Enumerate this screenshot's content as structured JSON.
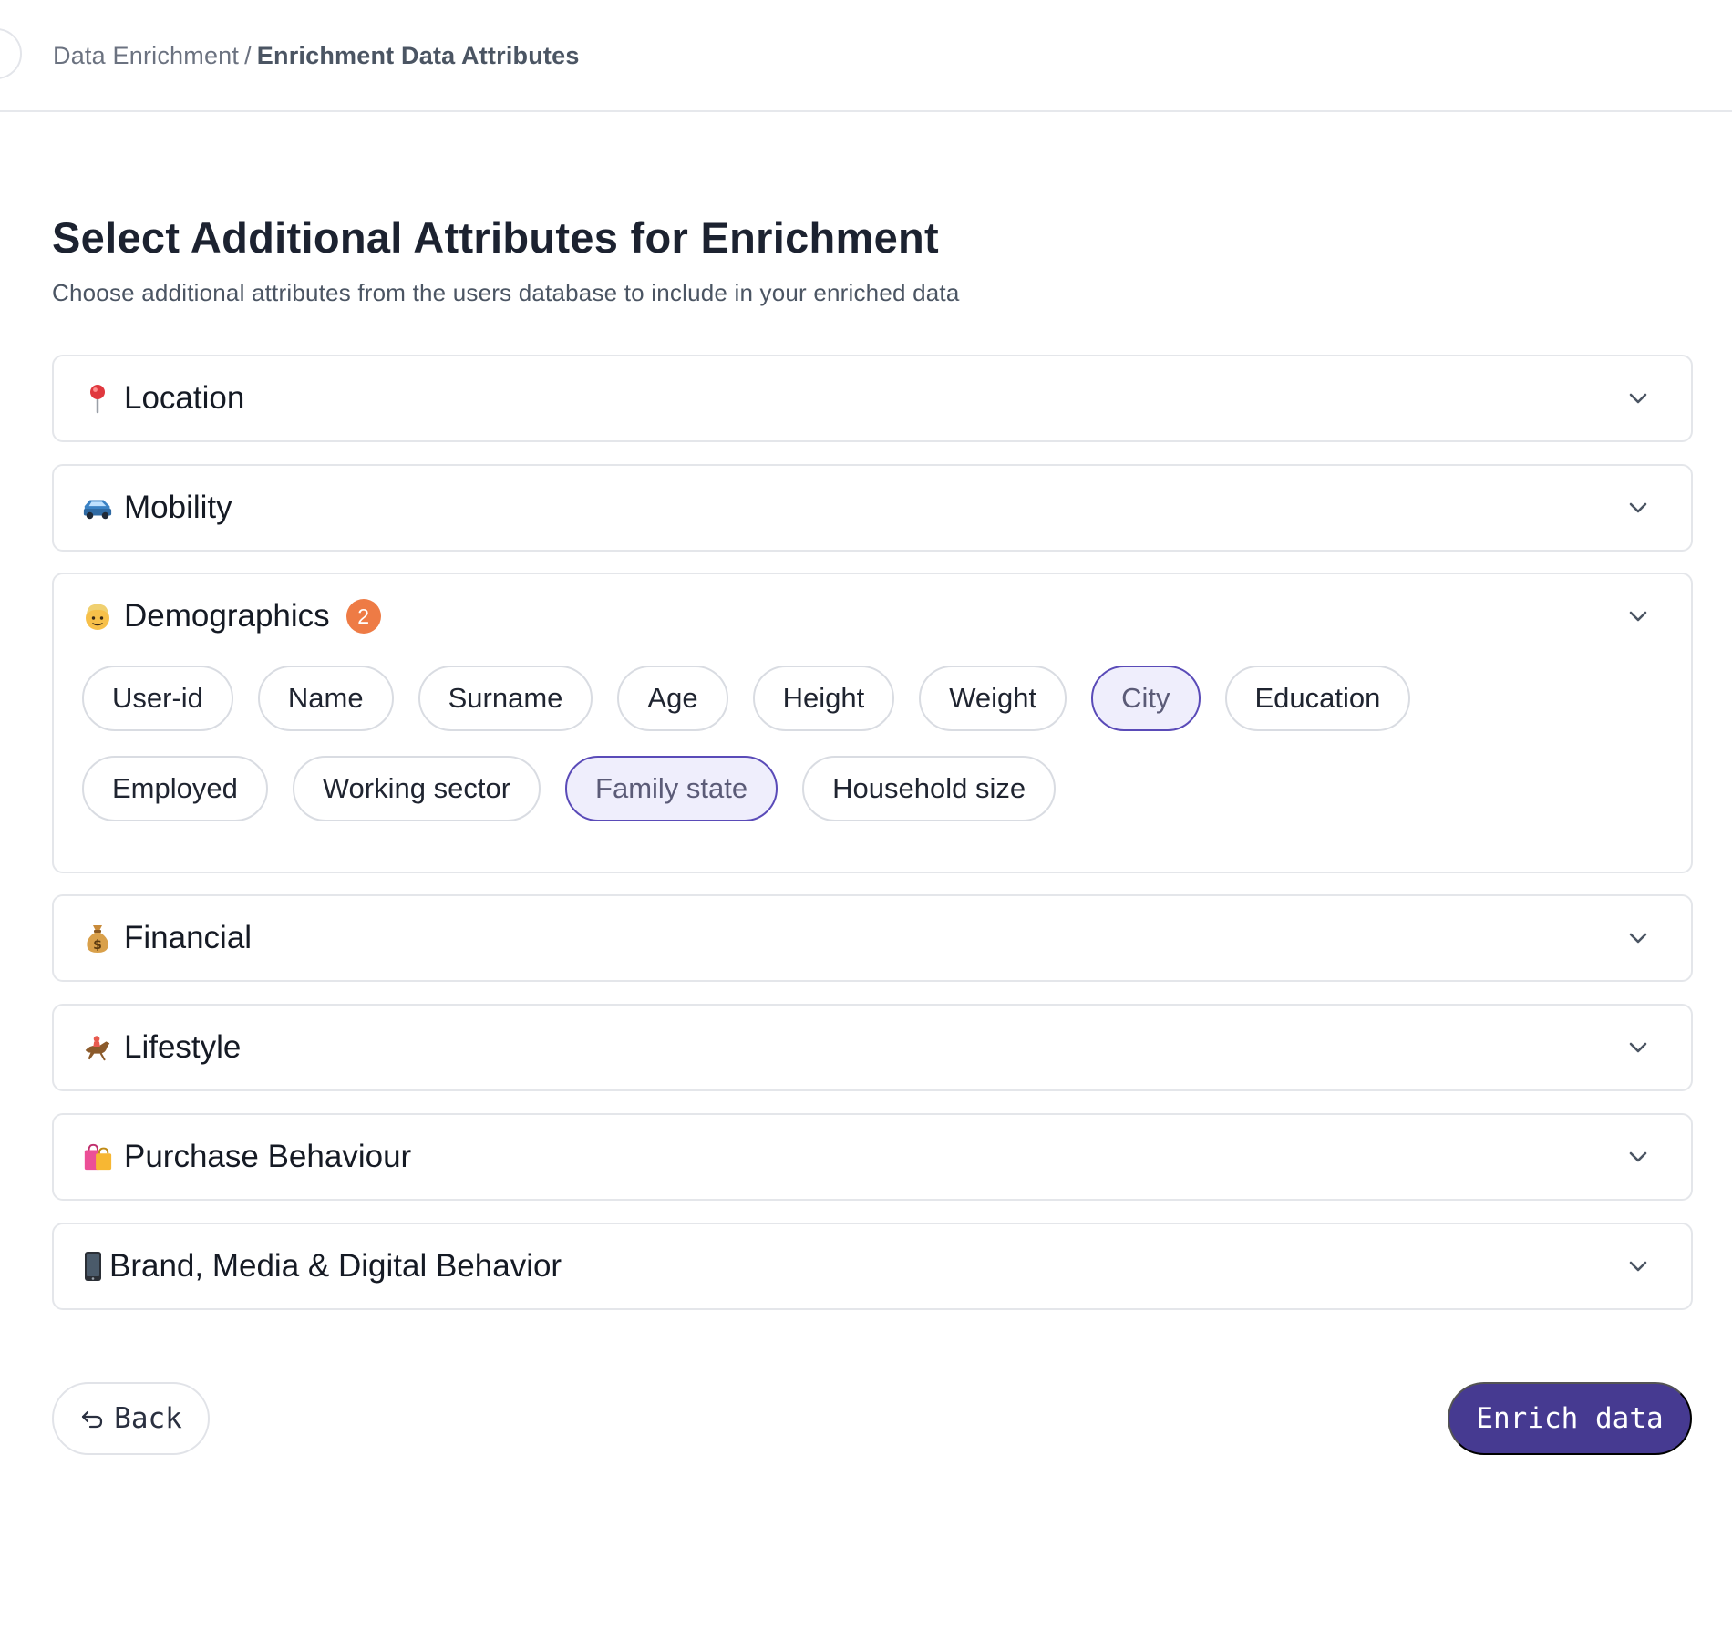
{
  "breadcrumb": {
    "parent": "Data Enrichment",
    "separator": "/",
    "current": "Enrichment Data Attributes"
  },
  "page": {
    "title": "Select Additional Attributes for Enrichment",
    "subtitle": "Choose additional attributes from the users database to include in your enriched data"
  },
  "sections": [
    {
      "label": "Location",
      "icon": "pin-icon",
      "expanded": false
    },
    {
      "label": "Mobility",
      "icon": "car-icon",
      "expanded": false
    },
    {
      "label": "Demographics",
      "icon": "person-icon",
      "expanded": true,
      "badge": "2",
      "chips_row1": [
        {
          "label": "User-id",
          "selected": false
        },
        {
          "label": "Name",
          "selected": false
        },
        {
          "label": "Surname",
          "selected": false
        },
        {
          "label": "Age",
          "selected": false
        },
        {
          "label": "Height",
          "selected": false
        },
        {
          "label": "Weight",
          "selected": false
        },
        {
          "label": "City",
          "selected": true
        },
        {
          "label": "Education",
          "selected": false
        }
      ],
      "chips_row2": [
        {
          "label": "Employed",
          "selected": false
        },
        {
          "label": "Working sector",
          "selected": false
        },
        {
          "label": "Family state",
          "selected": true
        },
        {
          "label": "Household size",
          "selected": false
        }
      ]
    },
    {
      "label": "Financial",
      "icon": "money-bag-icon",
      "expanded": false
    },
    {
      "label": "Lifestyle",
      "icon": "horse-racing-icon",
      "expanded": false
    },
    {
      "label": "Purchase Behaviour",
      "icon": "shopping-bags-icon",
      "expanded": false
    },
    {
      "label": "Brand, Media & Digital Behavior",
      "icon": "mobile-phone-icon",
      "expanded": false
    }
  ],
  "actions": {
    "back_label": "Back",
    "enrich_label": "Enrich data"
  },
  "colors": {
    "primary": "#463a91",
    "badge": "#ee7b45",
    "chip_selected_bg": "#efeefc",
    "chip_selected_border": "#5a4bb8"
  }
}
